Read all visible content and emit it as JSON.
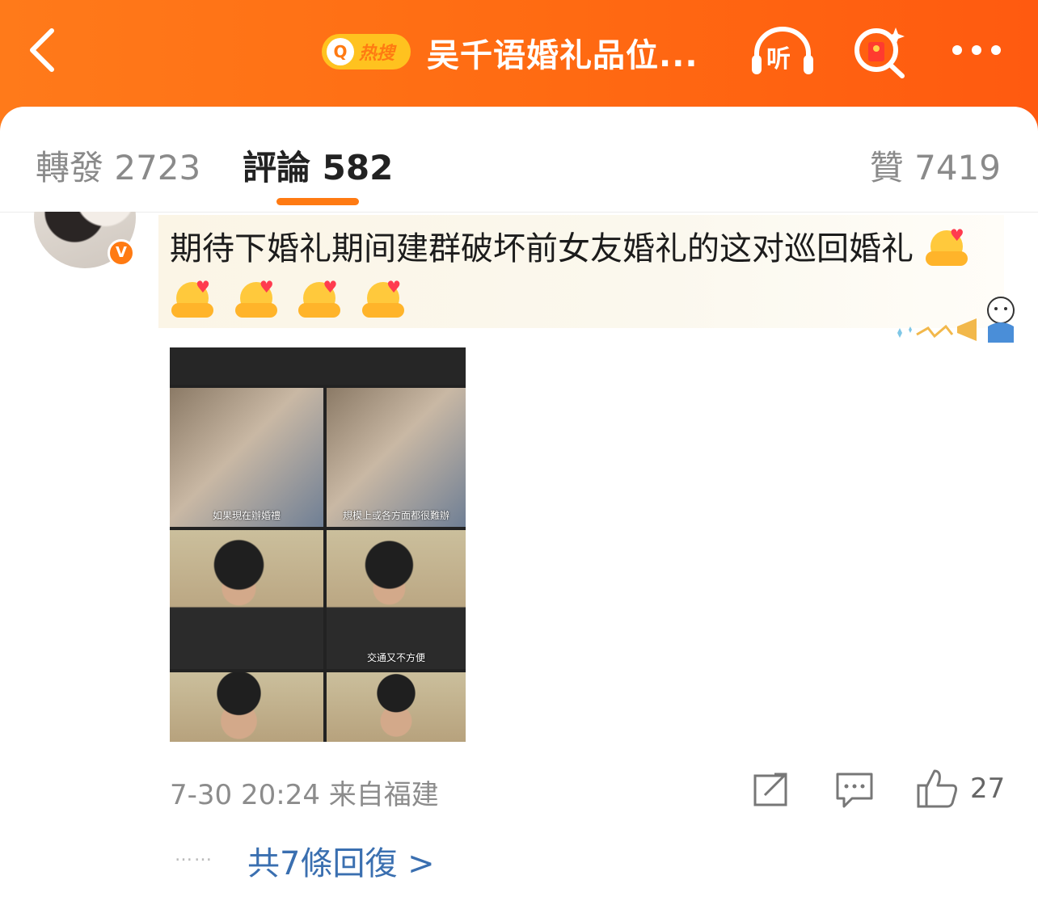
{
  "header": {
    "back_icon": "chevron-left-icon",
    "hot_badge_label": "热搜",
    "title": "吴千语婚礼品位...",
    "listen_label": "听",
    "brand_color": "#ff6a12"
  },
  "tabs": {
    "repost": "轉發 2723",
    "comments": "評論 582",
    "likes": "贊 7419"
  },
  "comment": {
    "verified_badge": "V",
    "text": "期待下婚礼期间建群破坏前女友婚礼的这对巡回婚礼",
    "image_captions": [
      "如果現在辦婚禮",
      "規模上或各方面都很難辦",
      "交通又不方便"
    ],
    "time_location": "7-30 20:24 来自福建",
    "like_count": "27"
  },
  "replies": {
    "dots": "……",
    "label": "共7條回復 >"
  }
}
